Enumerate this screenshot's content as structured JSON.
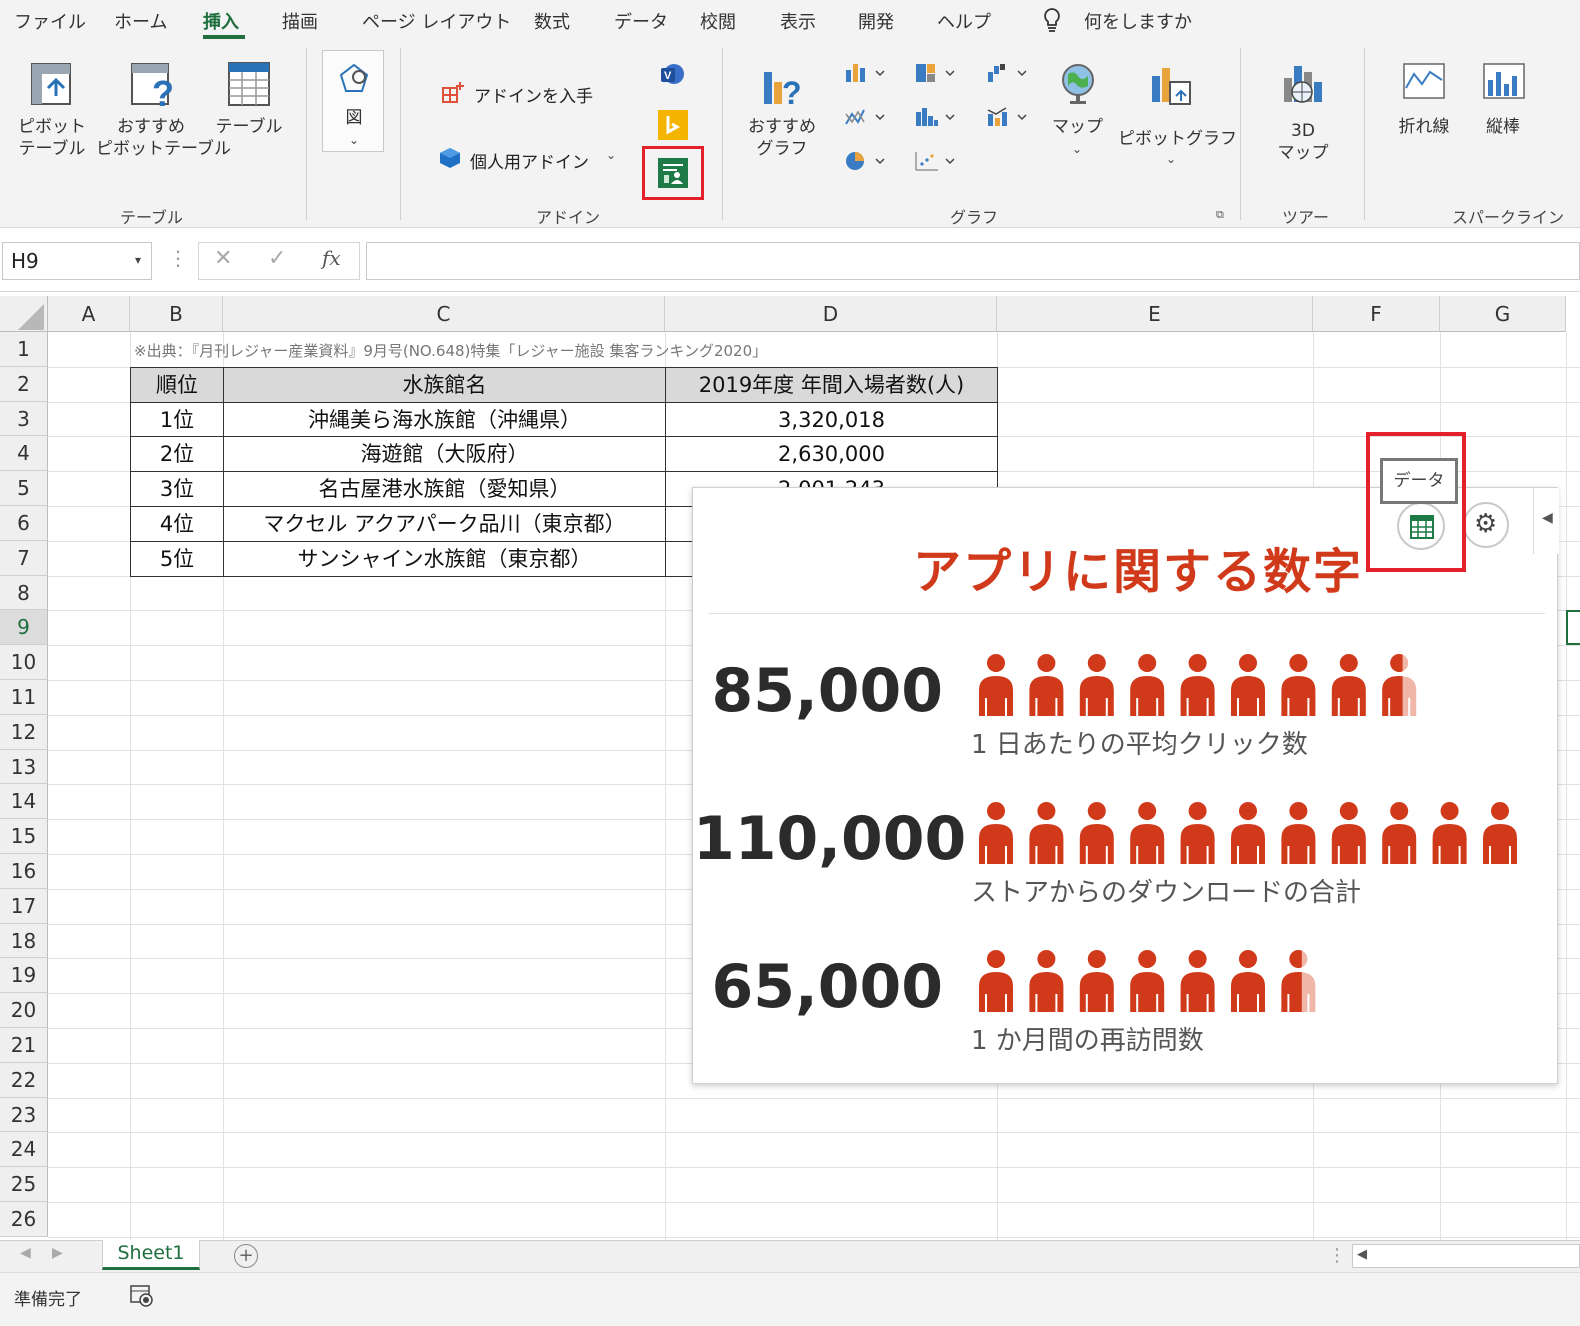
{
  "ribbon": {
    "tabs": [
      "ファイル",
      "ホーム",
      "挿入",
      "描画",
      "ページ レイアウト",
      "数式",
      "データ",
      "校閲",
      "表示",
      "開発",
      "ヘルプ"
    ],
    "active_tab": "挿入",
    "tell_me": "何をしますか",
    "buttons": {
      "pivot_table": "ピボット\nテーブル",
      "recommended_pivot": "おすすめ\nピボットテーブル",
      "table": "テーブル",
      "illustrations": "図",
      "get_addins": "アドインを入手",
      "my_addins": "個人用アドイン",
      "recommended_charts": "おすすめ\nグラフ",
      "maps": "マップ",
      "pivot_chart": "ピボットグラフ",
      "map_3d": "3D\nマップ",
      "spark_line": "折れ線",
      "spark_column": "縦棒"
    },
    "groups": {
      "table": "テーブル",
      "addins": "アドイン",
      "charts": "グラフ",
      "tours": "ツアー",
      "sparklines": "スパークライン"
    }
  },
  "formula_bar": {
    "name_box": "H9",
    "fx": "fx",
    "value": ""
  },
  "sheet": {
    "columns": [
      "A",
      "B",
      "C",
      "D",
      "E",
      "F",
      "G"
    ],
    "rows": [
      "1",
      "2",
      "3",
      "4",
      "5",
      "6",
      "7",
      "8",
      "9",
      "10",
      "11",
      "12",
      "13",
      "14",
      "15",
      "16",
      "17",
      "18",
      "19",
      "20",
      "21",
      "22",
      "23",
      "24",
      "25",
      "26"
    ],
    "note": "※出典：『月刊レジャー産業資料』9月号(NO.648)特集「レジャー施設 集客ランキング2020」",
    "table_header": [
      "順位",
      "水族館名",
      "2019年度 年間入場者数(人)"
    ],
    "table_rows": [
      [
        "1位",
        "沖縄美ら海水族館（沖縄県）",
        "3,320,018"
      ],
      [
        "2位",
        "海遊館（大阪府）",
        "2,630,000"
      ],
      [
        "3位",
        "名古屋港水族館（愛知県）",
        "2,001,243"
      ],
      [
        "4位",
        "マクセル アクアパーク品川（東京都）",
        ""
      ],
      [
        "5位",
        "サンシャイン水族館（東京都）",
        ""
      ]
    ]
  },
  "addin_panel": {
    "tooltip": "データ",
    "title": "アプリに関する数字",
    "stats": [
      {
        "value": "85,000",
        "label": "1 日あたりの平均クリック数",
        "icons": 8.6
      },
      {
        "value": "110,000",
        "label": "ストアからのダウンロードの合計",
        "icons": 11
      },
      {
        "value": "65,000",
        "label": "1 か月間の再訪問数",
        "icons": 6.6
      }
    ],
    "accent_color": "#d03a1b",
    "light_color": "#f0b6a8",
    "highlight_color": "#e4202a"
  },
  "sheet_tabs": {
    "active": "Sheet1"
  },
  "status": {
    "ready": "準備完了"
  }
}
